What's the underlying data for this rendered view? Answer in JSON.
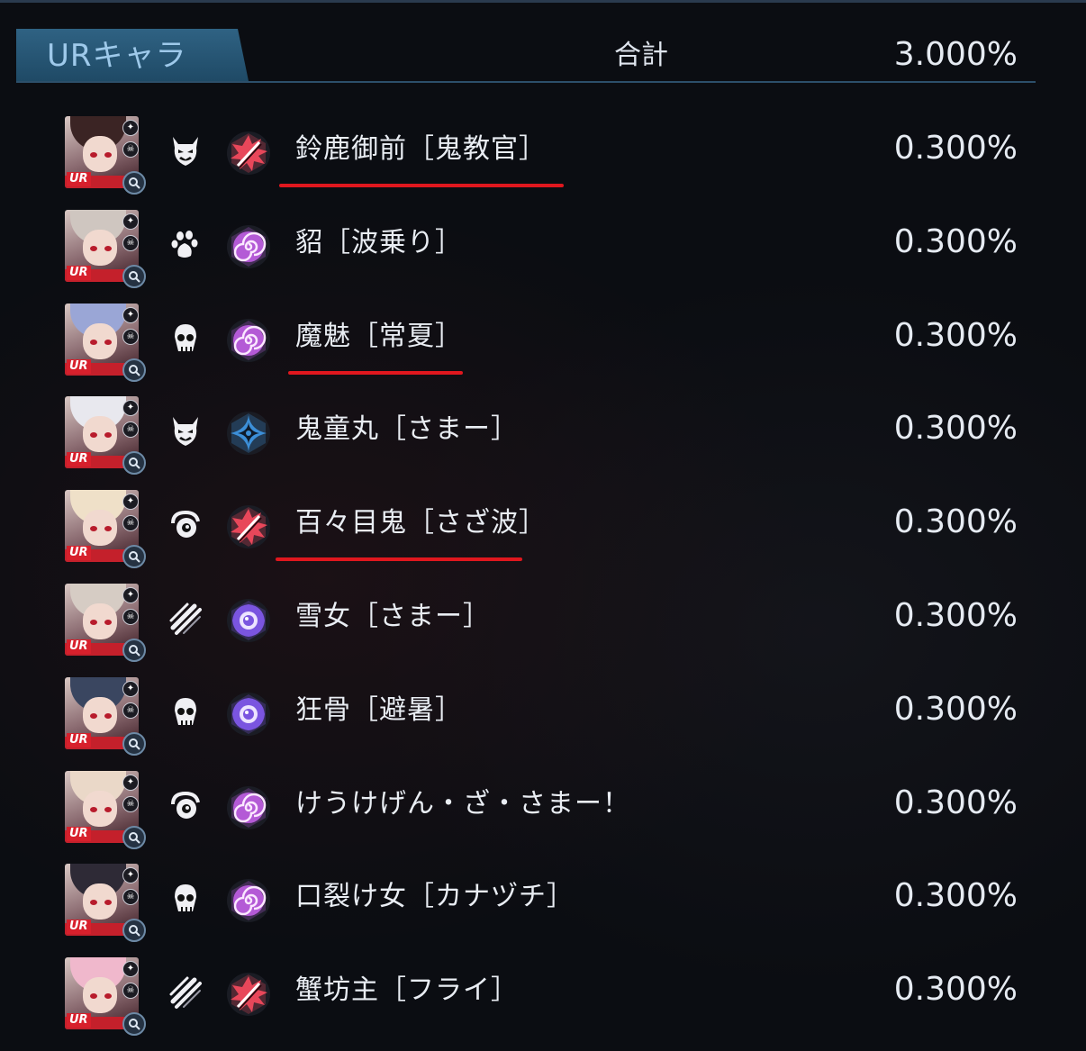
{
  "header": {
    "tab_label": "URキャラ",
    "total_label": "合計",
    "total_value": "3.000%"
  },
  "rows": [
    {
      "name": "鈴鹿御前［鬼教官］",
      "rate": "0.300%",
      "type_icon": "oni-mask-icon",
      "attr_icon": "slash-burst-icon",
      "attr_color": "#e8475a",
      "underlined": true
    },
    {
      "name": "貂［波乗り］",
      "rate": "0.300%",
      "type_icon": "paw-icon",
      "attr_icon": "spiral-icon",
      "attr_color": "#b45ad6",
      "underlined": false
    },
    {
      "name": "魔魅［常夏］",
      "rate": "0.300%",
      "type_icon": "skull-icon",
      "attr_icon": "spiral-icon",
      "attr_color": "#b45ad6",
      "underlined": true
    },
    {
      "name": "鬼童丸［さまー］",
      "rate": "0.300%",
      "type_icon": "oni-mask-icon",
      "attr_icon": "shuriken-icon",
      "attr_color": "#3c8fd8",
      "underlined": false
    },
    {
      "name": "百々目鬼［さざ波］",
      "rate": "0.300%",
      "type_icon": "swirl-eye-icon",
      "attr_icon": "slash-burst-icon",
      "attr_color": "#e8475a",
      "underlined": true
    },
    {
      "name": "雪女［さまー］",
      "rate": "0.300%",
      "type_icon": "claw-marks-icon",
      "attr_icon": "eye-orb-icon",
      "attr_color": "#7a55e0",
      "underlined": false
    },
    {
      "name": "狂骨［避暑］",
      "rate": "0.300%",
      "type_icon": "skull-icon",
      "attr_icon": "eye-orb-icon",
      "attr_color": "#7a55e0",
      "underlined": false
    },
    {
      "name": "けうけげん・ざ・さまー！",
      "rate": "0.300%",
      "type_icon": "swirl-eye-icon",
      "attr_icon": "spiral-icon",
      "attr_color": "#b45ad6",
      "underlined": false
    },
    {
      "name": "口裂け女［カナヅチ］",
      "rate": "0.300%",
      "type_icon": "skull-icon",
      "attr_icon": "spiral-icon",
      "attr_color": "#b45ad6",
      "underlined": false
    },
    {
      "name": "蟹坊主［フライ］",
      "rate": "0.300%",
      "type_icon": "claw-marks-icon",
      "attr_icon": "slash-burst-icon",
      "attr_color": "#e8475a",
      "underlined": false
    }
  ],
  "badge_text": "UR",
  "colors": {
    "background": "#0b0d12",
    "header_tab": "#2f6283",
    "header_line": "#2c4f6a",
    "text": "#e9edf3",
    "underline": "#e0171e",
    "ur_red": "#d7202c"
  }
}
